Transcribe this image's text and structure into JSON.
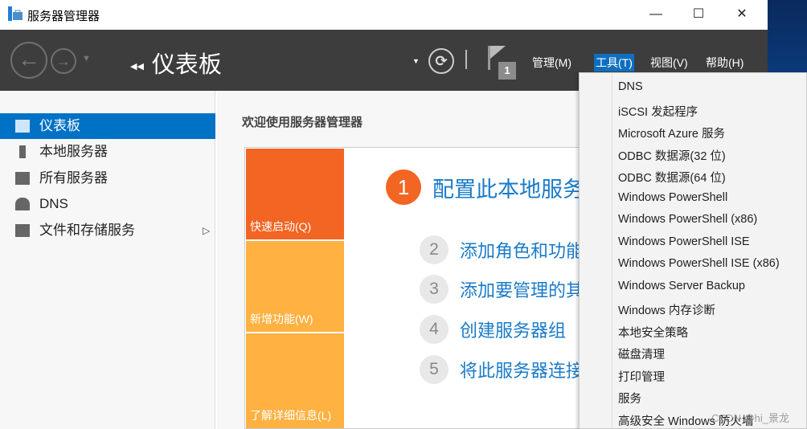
{
  "window": {
    "title": "服务器管理器",
    "minimize": "—",
    "maximize": "☐",
    "close": "✕"
  },
  "header": {
    "breadcrumb": "仪表板",
    "notification_count": "1",
    "menus": [
      "管理(M)",
      "工具(T)",
      "视图(V)",
      "帮助(H)"
    ],
    "active_menu": "工具(T)"
  },
  "sidebar": {
    "items": [
      {
        "label": "仪表板",
        "icon": "dashboard-icon",
        "selected": true
      },
      {
        "label": "本地服务器",
        "icon": "server-icon"
      },
      {
        "label": "所有服务器",
        "icon": "servers-icon"
      },
      {
        "label": "DNS",
        "icon": "dns-icon"
      },
      {
        "label": "文件和存储服务",
        "icon": "storage-icon",
        "expand": "▷"
      }
    ]
  },
  "main": {
    "welcome": "欢迎使用服务器管理器",
    "tiles": [
      "快速启动(Q)",
      "新增功能(W)",
      "了解详细信息(L)"
    ],
    "steps": [
      {
        "n": "1",
        "label": "配置此本地服务器"
      },
      {
        "n": "2",
        "label": "添加角色和功能"
      },
      {
        "n": "3",
        "label": "添加要管理的其他服务器"
      },
      {
        "n": "4",
        "label": "创建服务器组"
      },
      {
        "n": "5",
        "label": "将此服务器连接到云服务"
      }
    ]
  },
  "tools_menu": [
    "DNS",
    "iSCSI 发起程序",
    "Microsoft Azure 服务",
    "ODBC 数据源(32 位)",
    "ODBC 数据源(64 位)",
    "Windows PowerShell",
    "Windows PowerShell (x86)",
    "Windows PowerShell ISE",
    "Windows PowerShell ISE (x86)",
    "Windows Server Backup",
    "Windows 内存诊断",
    "本地安全策略",
    "磁盘清理",
    "打印管理",
    "服务",
    "高级安全 Windows 防火墙"
  ],
  "watermark": "CSDN @hi_景龙",
  "colors": {
    "accent": "#0072c6",
    "orange": "#f26522",
    "light_orange": "#ffb142"
  }
}
